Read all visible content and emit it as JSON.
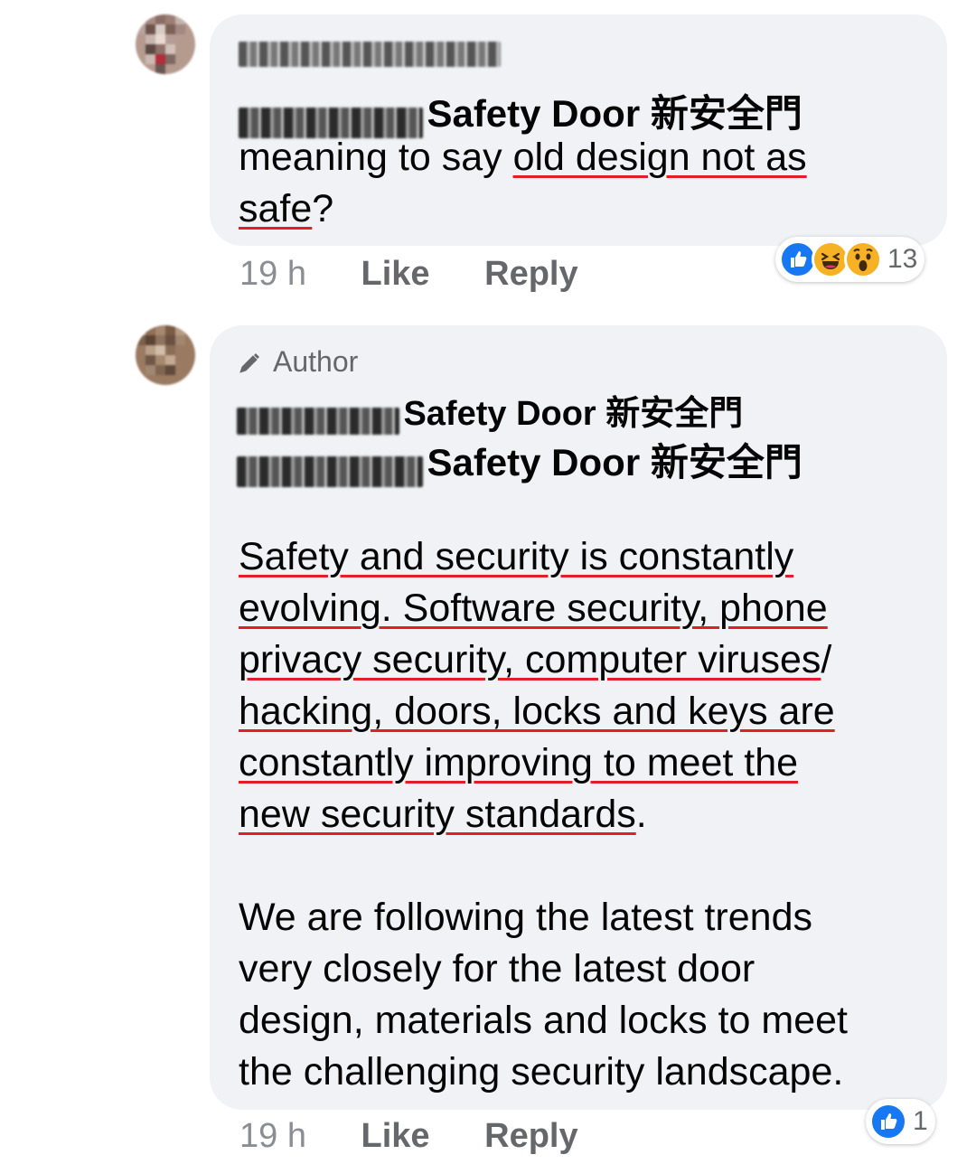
{
  "comments": [
    {
      "reply_to": "Safety Door 新安全門",
      "text_before": "meaning to say ",
      "text_underlined_1": "old design not as",
      "text_underlined_2": "safe",
      "text_after": "?",
      "time": "19 h",
      "like_label": "Like",
      "reply_label": "Reply",
      "reaction_count": "13",
      "reactions": [
        "like-icon",
        "haha-icon",
        "wow-icon"
      ]
    },
    {
      "author_badge": "Author",
      "page_name": "Safety Door 新安全門",
      "reply_to": "Safety Door 新安全門",
      "para1_lines": [
        "Safety and security is constantly",
        "evolving.  Software security, phone",
        "privacy security, computer viruses",
        "hacking, doors, locks and keys are",
        "constantly improving to meet the",
        "new security standards"
      ],
      "para1_line3_suffix": "/",
      "para1_end": ".",
      "para2_lines": [
        "We are following the latest trends",
        "very closely for the latest door",
        "design, materials and locks to meet",
        "the challenging security landscape."
      ],
      "time": "19 h",
      "like_label": "Like",
      "reply_label": "Reply",
      "reaction_count": "1",
      "reactions": [
        "like-icon"
      ]
    }
  ],
  "colors": {
    "bubble": "#f0f2f5",
    "underline": "#e41e26",
    "like_blue": "#1877f2",
    "secondary_text": "#65676b"
  }
}
